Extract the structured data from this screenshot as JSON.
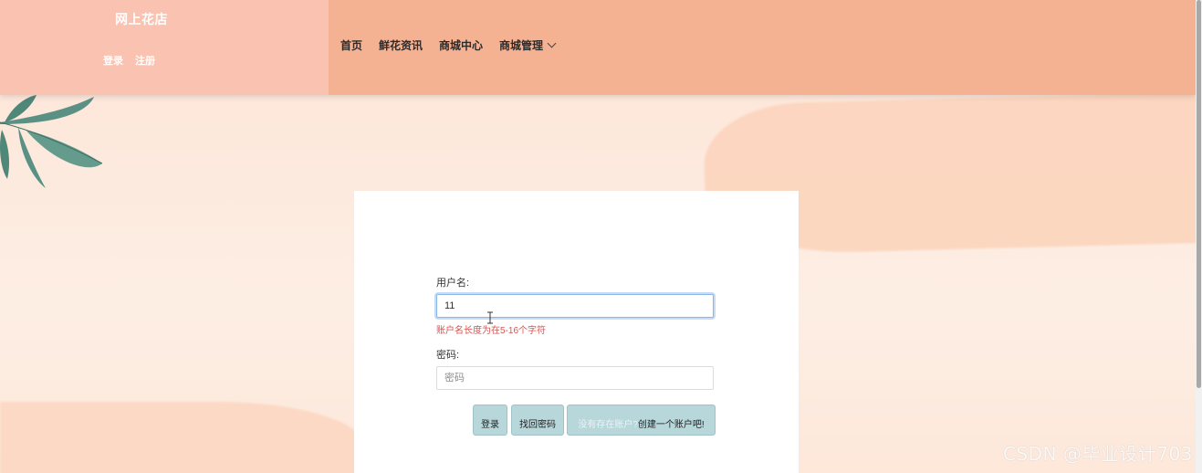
{
  "header": {
    "site_title": "网上花店",
    "auth": {
      "login": "登录",
      "register": "注册"
    },
    "nav": [
      {
        "label": "首页"
      },
      {
        "label": "鲜花资讯"
      },
      {
        "label": "商城中心"
      },
      {
        "label": "商城管理",
        "has_dropdown": true
      }
    ],
    "colors": {
      "brand_block": "#fac3b1",
      "nav_block": "#f5b293"
    }
  },
  "login_form": {
    "username_label": "用户名:",
    "username_value": "11",
    "username_error": "账户名长度为在5-16个字符",
    "password_label": "密码:",
    "password_placeholder": "密码",
    "buttons": {
      "login": "登录",
      "forgot": "找回密码",
      "register_part1": "没有存在账户?",
      "register_part2": "创建一个账户吧!"
    },
    "colors": {
      "button_bg": "#b7d7db",
      "error": "#d9534f",
      "focus_border": "#89b7e6"
    }
  },
  "decorations": {
    "leaves_icon": "leaves-icon",
    "cursor_icon": "text-cursor-icon"
  },
  "watermark": "CSDN @毕业设计703"
}
